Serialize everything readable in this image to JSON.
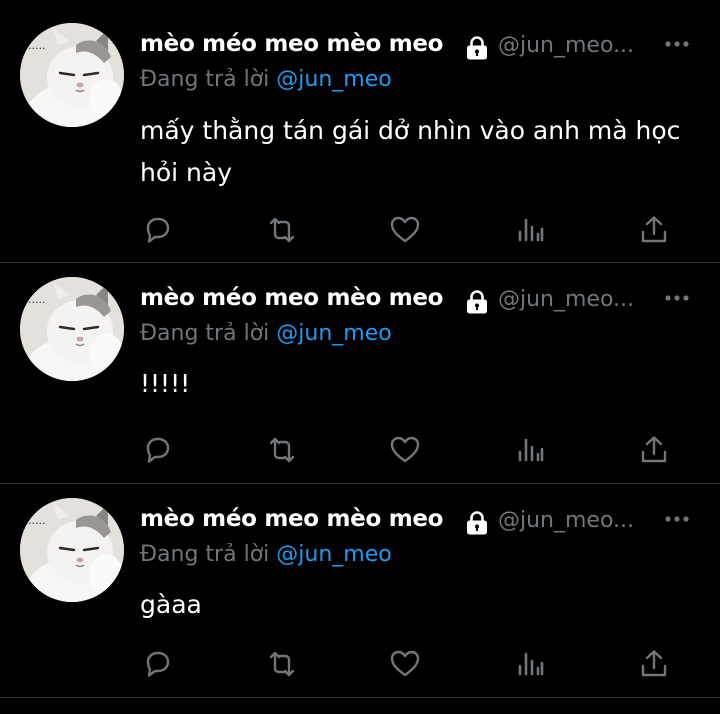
{
  "colors": {
    "background": "#000000",
    "text_primary": "#ffffff",
    "text_secondary": "#71767b",
    "accent": "#1d9bf0",
    "divider": "#2f3336",
    "icon": "#71767b"
  },
  "author": {
    "display_name": "mèo méo meo mèo meo",
    "handle": "@jun_meo...",
    "avatar_dots": "....."
  },
  "icons": {
    "verified_lock": "lock-icon",
    "more": "more-icon",
    "reply": "reply-icon",
    "retweet": "retweet-icon",
    "like": "heart-icon",
    "views": "views-icon",
    "share": "share-icon"
  },
  "tweets": [
    {
      "reply_prefix": "Đang trả lời",
      "reply_to": "@jun_meo",
      "text": "mấy thằng tán gái dở nhìn vào anh mà học hỏi này"
    },
    {
      "reply_prefix": "Đang trả lời",
      "reply_to": "@jun_meo",
      "text": "!!!!!"
    },
    {
      "reply_prefix": "Đang trả lời",
      "reply_to": "@jun_meo",
      "text": "gàaa"
    }
  ]
}
